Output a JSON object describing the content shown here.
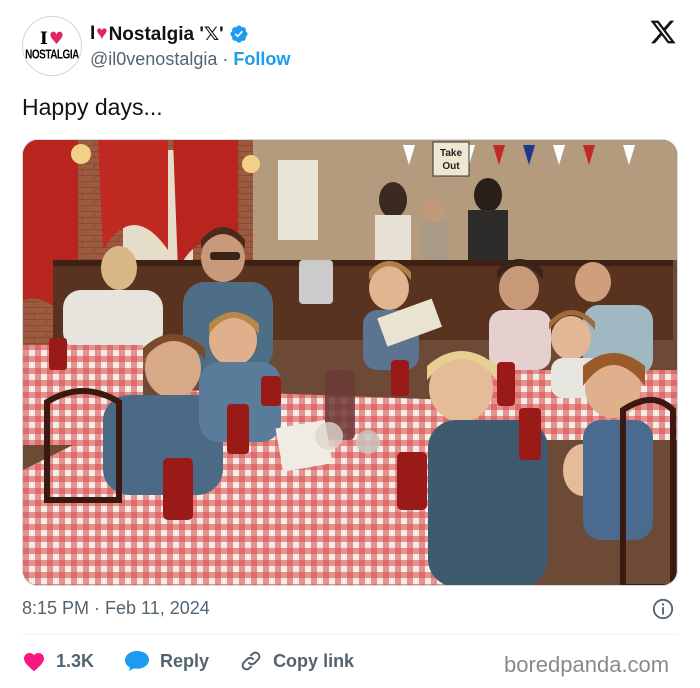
{
  "author": {
    "avatar_line1": "I",
    "avatar_line2": "NOSTALGIA",
    "display_name_prefix": "I",
    "display_name_suffix": "Nostalgia '𝕏'",
    "handle": "@il0venostalgia",
    "separator": "·",
    "follow_label": "Follow"
  },
  "tweet": {
    "text": "Happy days...",
    "timestamp": "8:15 PM · Feb 11, 2024"
  },
  "photo": {
    "sign_text_line1": "Take",
    "sign_text_line2": "Out"
  },
  "actions": {
    "like_count": "1.3K",
    "reply_label": "Reply",
    "copy_link_label": "Copy link"
  },
  "watermark": "boredpanda.com",
  "colors": {
    "like": "#f91880",
    "reply": "#1d9bf0",
    "follow": "#1d9bf0",
    "verified": "#1d9bf0",
    "secondary_text": "#536471"
  },
  "icons": {
    "verified": "verified-badge-icon",
    "platform": "x-logo-icon",
    "info": "info-icon",
    "like": "heart-icon",
    "reply": "speech-bubble-icon",
    "copy": "link-icon"
  }
}
